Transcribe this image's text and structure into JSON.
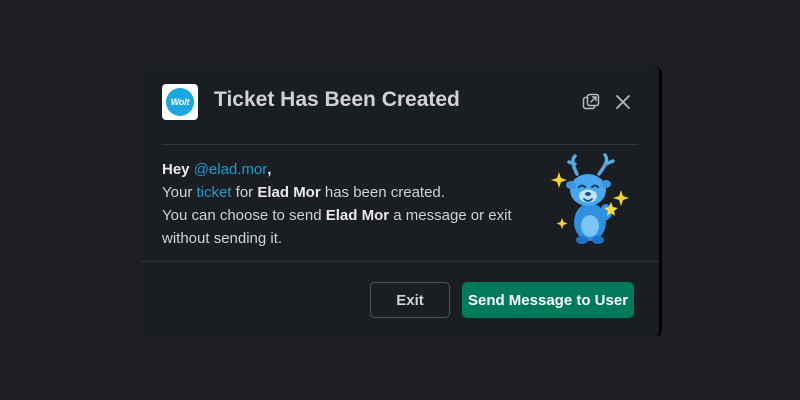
{
  "modal": {
    "title": "Ticket Has Been Created",
    "app_logo_text": "Wolt",
    "icons": {
      "logo": "wolt-logo-icon",
      "popout": "popout-window-icon",
      "close": "close-icon",
      "mascot": "reindeer-mascot-icon"
    }
  },
  "message": {
    "greeting": "Hey ",
    "mention": "@elad.mor",
    "greeting_end": ",",
    "line2_start": "Your ",
    "ticket_link": "ticket",
    "line2_mid": " for ",
    "name": "Elad Mor",
    "line2_end": " has been created.",
    "line3_start": "You can choose to send ",
    "line3_end": " a message or exit",
    "line4": "without sending it."
  },
  "actions": {
    "exit_label": "Exit",
    "send_label": "Send Message to User"
  },
  "colors": {
    "background": "#1d1e22",
    "modal": "#1a1d21",
    "link": "#1d9bd1",
    "primary_button": "#007a5a",
    "logo": "#1ca7de"
  }
}
